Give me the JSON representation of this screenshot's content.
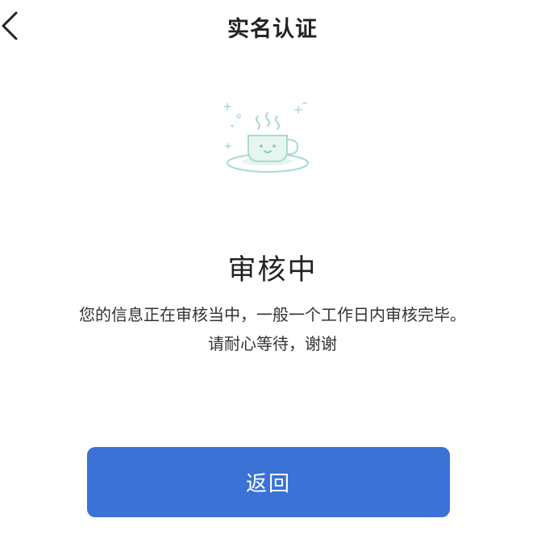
{
  "header": {
    "title": "实名认证",
    "back_icon": "chevron-left-icon"
  },
  "status": {
    "icon": "coffee-cup-icon",
    "title": "审核中",
    "message_line1": "您的信息正在审核当中，一般一个工作日内审核完毕。",
    "message_line2": "请耐心等待，谢谢"
  },
  "actions": {
    "return_label": "返回"
  },
  "colors": {
    "accent": "#3a72d6",
    "illustration": "#a8dcc9"
  }
}
